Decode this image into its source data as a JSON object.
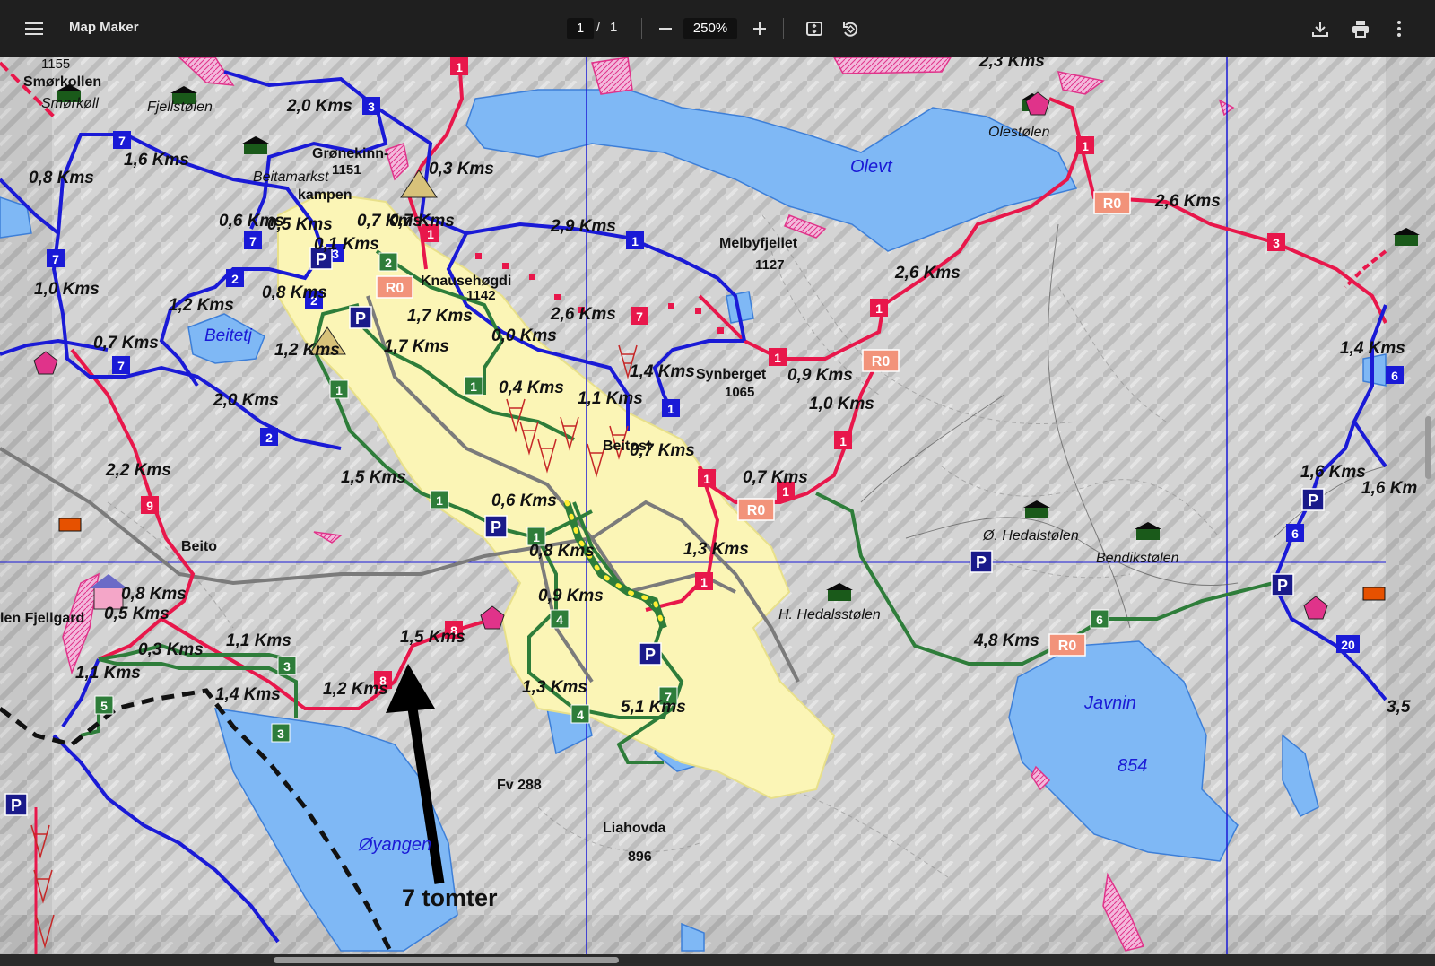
{
  "toolbar": {
    "app_title": "Map Maker",
    "page_current": "1",
    "page_separator": "/",
    "page_total": "1",
    "zoom": "250%",
    "icons": [
      "menu-icon",
      "zoom-out-icon",
      "zoom-in-icon",
      "fit-page-icon",
      "rotate-icon",
      "download-icon",
      "print-icon",
      "more-vert-icon"
    ]
  },
  "map": {
    "places": {
      "smorkollen_height": "1155",
      "smorkollen": "Smørkollen",
      "smorkoll": "Smørkøll",
      "fjellstolen": "Fjellstølen",
      "gronekinn": "Grønekinn-",
      "gronekinn_height": "1151",
      "beitamarkst": "Beitamarkst",
      "kampen": "kampen",
      "knausehogdi": "Knausehøgdi",
      "knausehogdi_height": "1142",
      "melbyfjellet": "Melbyfjellet",
      "melbyfjellet_height": "1127",
      "olevt": "Olevt",
      "olestolen": "Olestølen",
      "beitetj": "Beitetj",
      "synberget": "Synberget",
      "synberget_height": "1065",
      "beitost": "Beitost",
      "beito": "Beito",
      "hedalstolen_o": "Ø. Hedalstølen",
      "bendikstolen": "Bendikstølen",
      "hedalsstolen_h": "H. Hedalsstølen",
      "fjellgard": "len Fjellgard",
      "javnin": "Javnin",
      "javnin_height": "854",
      "fv288": "Fv 288",
      "liahovda": "Liahovda",
      "liahovda_height": "896",
      "oyangen": "Øyangen"
    },
    "annotation": "7 tomter",
    "distances": {
      "d01": "2,0 Kms",
      "d02": "1,6 Kms",
      "d03": "0,8 Kms",
      "d04": "0,3 Kms",
      "d05": "0,6 Kms",
      "d06": "0,5 Kms",
      "d07": "0,7 Kms",
      "d08": "0,7 Kms",
      "d09": "0,1 Kms",
      "d10": "2,9 Kms",
      "d11": "1,0 Kms",
      "d12": "1,2 Kms",
      "d13": "0,8 Kms",
      "d14": "1,7 Kms",
      "d15": "2,6 Kms",
      "d16": "0,7 Kms",
      "d17": "1,2 Kms",
      "d18": "1,7 Kms",
      "d19": "0,0 Kms",
      "d20": "2,0 Kms",
      "d21": "0,4 Kms",
      "d22": "1,1 Kms",
      "d23": "1,4 Kms",
      "d24": "0,9 Kms",
      "d25": "1,0 Kms",
      "d26": "2,6 Kms",
      "d27": "2,6 Kms",
      "d28": "1,4 Kms",
      "d29": "2,2 Kms",
      "d30": "1,5 Kms",
      "d31": "0,7 Kms",
      "d32": "0,6 Kms",
      "d33": "0,7 Kms",
      "d34": "0,8 Kms",
      "d35": "1,3 Kms",
      "d36": "1,6 Kms",
      "d37": "1,6 Km",
      "d38": "0,8 Kms",
      "d39": "0,5 Kms",
      "d40": "0,9 Kms",
      "d41": "1,1 Kms",
      "d42": "0,3 Kms",
      "d43": "1,5 Kms",
      "d44": "1,1 Kms",
      "d45": "4,8 Kms",
      "d46": "1,4 Kms",
      "d47": "1,2 Kms",
      "d48": "1,3 Kms",
      "d49": "5,1 Kms",
      "d50": "2,3 Kms",
      "d51": "3,5"
    },
    "route_markers": {
      "r0": "R0"
    },
    "parking": "P",
    "colors": {
      "red_route": "#e8174b",
      "blue_route": "#1a1ad6",
      "green_route": "#2e7d3a",
      "lake": "#7fb8f5",
      "resort": "#fbf5b6"
    }
  }
}
